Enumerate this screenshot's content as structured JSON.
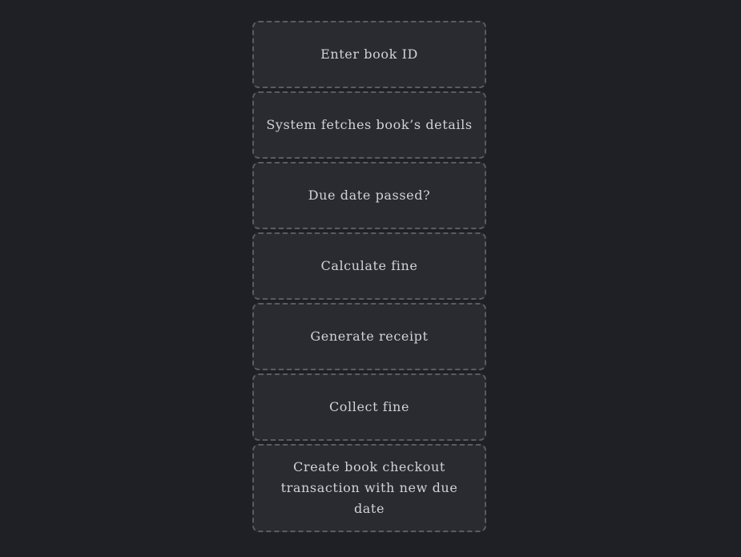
{
  "diagram": {
    "steps": [
      "Enter book ID",
      "System fetches book’s details",
      "Due date passed?",
      "Calculate fine",
      "Generate receipt",
      "Collect fine",
      "Create book checkout transaction with new due date"
    ]
  }
}
